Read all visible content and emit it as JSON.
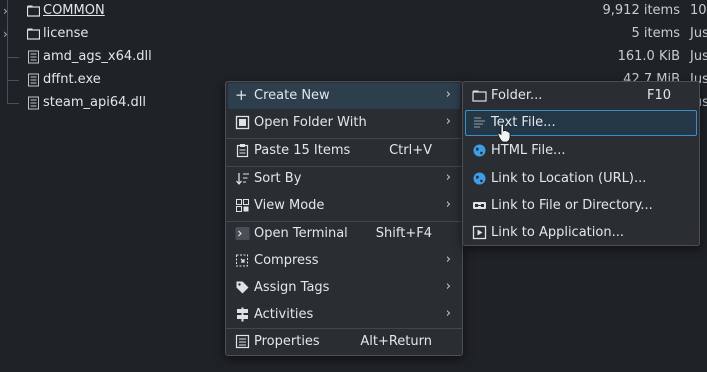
{
  "files": [
    {
      "name": "COMMON",
      "size": "9,912 items",
      "date": "10.",
      "expandable": true,
      "kind": "folder"
    },
    {
      "name": "license",
      "size": "5 items",
      "date": "Jus",
      "expandable": true,
      "kind": "folder"
    },
    {
      "name": "amd_ags_x64.dll",
      "size": "161.0 KiB",
      "date": "Jus",
      "expandable": false,
      "kind": "file"
    },
    {
      "name": "dffnt.exe",
      "size": "42.7 MiB",
      "date": "Jus",
      "expandable": false,
      "kind": "file"
    },
    {
      "name": "steam_api64.dll",
      "size": "",
      "date": "Jus",
      "expandable": false,
      "kind": "file"
    }
  ],
  "context_menu": {
    "create_new": "Create New",
    "open_folder_with": "Open Folder With",
    "paste": "Paste 15 Items",
    "paste_shortcut": "Ctrl+V",
    "sort_by": "Sort By",
    "view_mode": "View Mode",
    "open_terminal": "Open Terminal",
    "open_terminal_shortcut": "Shift+F4",
    "compress": "Compress",
    "assign_tags": "Assign Tags",
    "activities": "Activities",
    "properties": "Properties",
    "properties_shortcut": "Alt+Return"
  },
  "submenu": {
    "folder": "Folder...",
    "folder_shortcut": "F10",
    "text_file": "Text File...",
    "html_file": "HTML File...",
    "link_url": "Link to Location (URL)...",
    "link_file": "Link to File or Directory...",
    "link_app": "Link to Application..."
  },
  "colors": {
    "background": "#1f2226",
    "menu_background": "#2a2e32",
    "highlight_border": "#3b8fc9",
    "globe_blue": "#3d9ee8"
  }
}
